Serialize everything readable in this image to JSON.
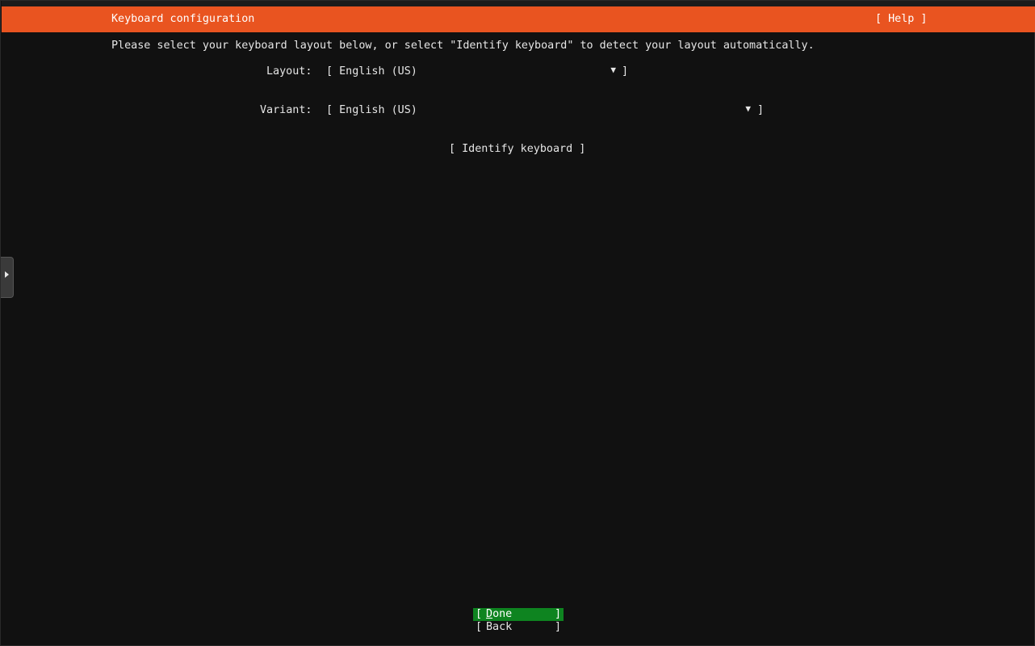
{
  "header": {
    "title": "Keyboard configuration",
    "help_label": "[ Help ]"
  },
  "instructions": "Please select your keyboard layout below, or select \"Identify keyboard\" to detect your layout automatically.",
  "layout_field": {
    "label": "Layout:",
    "open_bracket": "[",
    "value": "English (US)",
    "arrow": "▼",
    "close_bracket": "]"
  },
  "variant_field": {
    "label": "Variant:",
    "open_bracket": "[",
    "value": "English (US)",
    "arrow": "▼",
    "close_bracket": "]"
  },
  "identify_button": "[ Identify keyboard ]",
  "buttons": {
    "open_bracket": "[",
    "close_bracket": "]",
    "done": "Done",
    "back": "Back"
  },
  "colors": {
    "header_bg": "#e95420",
    "done_bg": "#0e8420",
    "screen_bg": "#111111"
  },
  "icons": {
    "sidebar_toggle": "triangle-right-icon"
  }
}
